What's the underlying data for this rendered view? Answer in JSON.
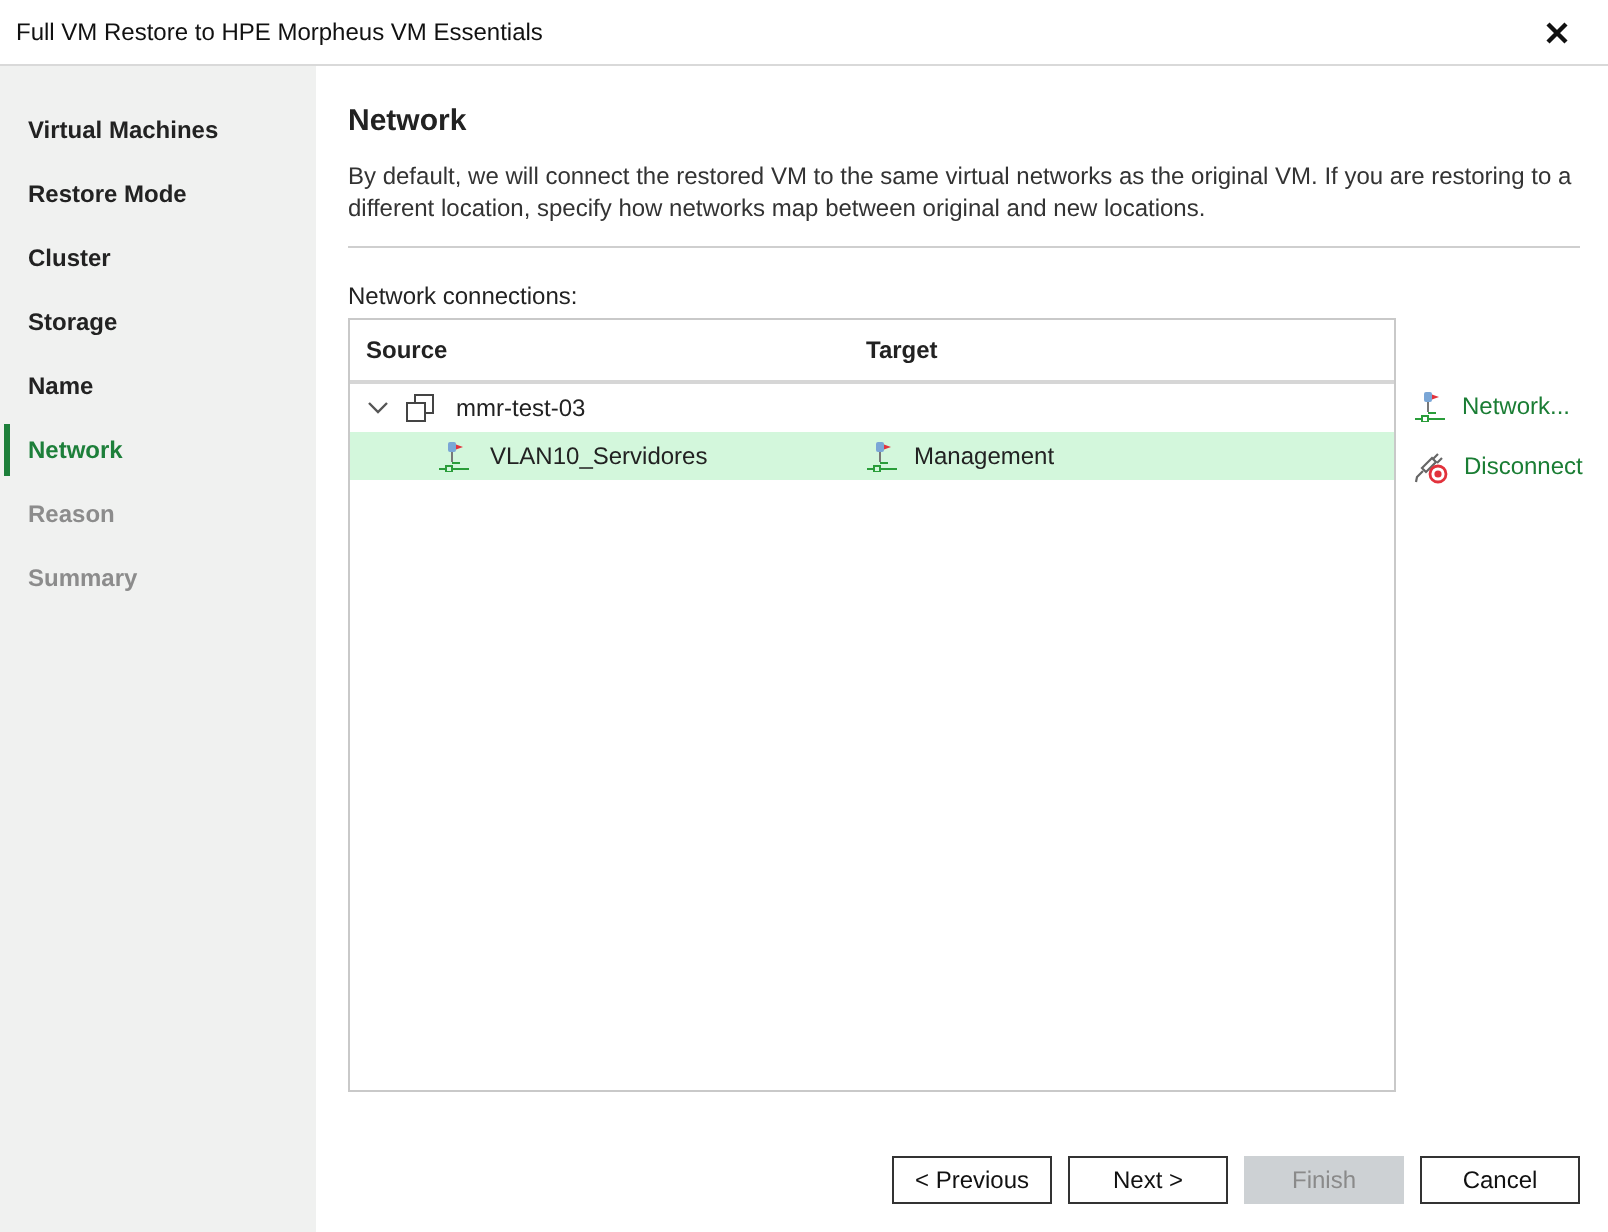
{
  "window": {
    "title": "Full VM Restore to HPE Morpheus VM Essentials"
  },
  "sidebar": {
    "items": [
      {
        "label": "Virtual Machines",
        "selected": false,
        "disabled": false
      },
      {
        "label": "Restore Mode",
        "selected": false,
        "disabled": false
      },
      {
        "label": "Cluster",
        "selected": false,
        "disabled": false
      },
      {
        "label": "Storage",
        "selected": false,
        "disabled": false
      },
      {
        "label": "Name",
        "selected": false,
        "disabled": false
      },
      {
        "label": "Network",
        "selected": true,
        "disabled": false
      },
      {
        "label": "Reason",
        "selected": false,
        "disabled": true
      },
      {
        "label": "Summary",
        "selected": false,
        "disabled": true
      }
    ]
  },
  "page": {
    "heading": "Network",
    "description": "By default, we will connect the restored VM to the same virtual networks as the original VM. If you are restoring to a different location, specify how networks map between original and new locations.",
    "list_label": "Network connections:"
  },
  "table": {
    "columns": [
      "Source",
      "Target"
    ],
    "rows": [
      {
        "kind": "vm",
        "source": "mmr-test-03",
        "selected": false,
        "expanded": true,
        "children": [
          {
            "kind": "network",
            "source": "VLAN10_Servidores",
            "target": "Management",
            "selected": true
          }
        ]
      }
    ]
  },
  "actions": [
    {
      "kind": "network",
      "label": "Network..."
    },
    {
      "kind": "disconnect",
      "label": "Disconnect"
    }
  ],
  "buttons": [
    {
      "label": "< Previous",
      "disabled": false
    },
    {
      "label": "Next >",
      "disabled": false
    },
    {
      "label": "Finish",
      "disabled": true
    },
    {
      "label": "Cancel",
      "disabled": false
    }
  ]
}
